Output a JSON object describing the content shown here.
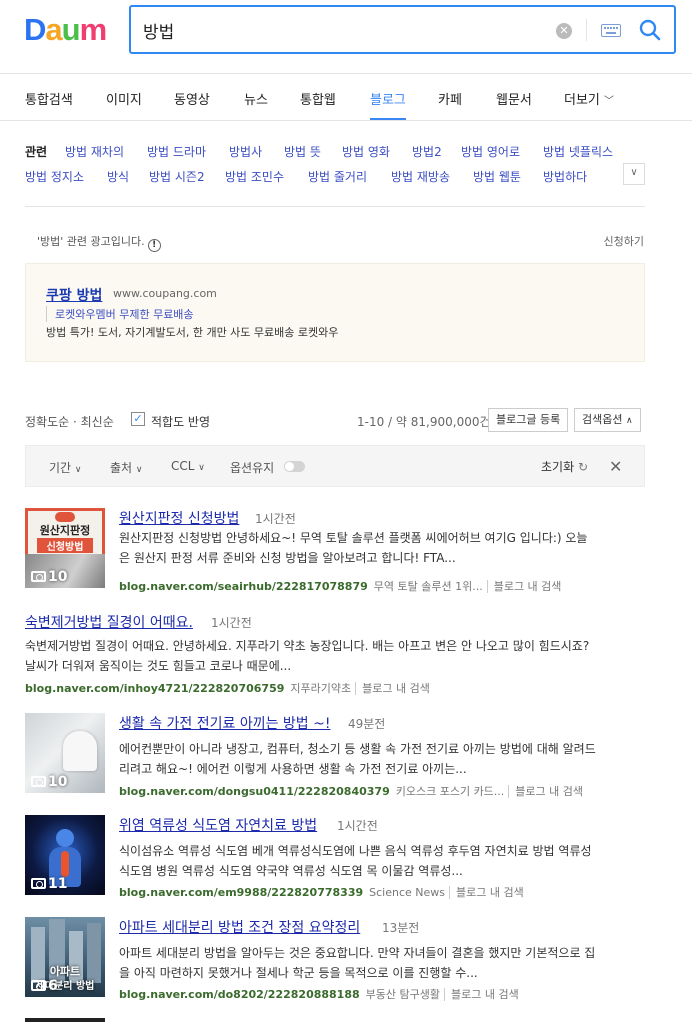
{
  "header": {
    "logo": [
      "D",
      "a",
      "u",
      "m"
    ],
    "logo_colors": [
      "#2b73f0",
      "#f5a623",
      "#4cbf4a",
      "#f23e6f"
    ],
    "query": "방법"
  },
  "tabs": [
    "통합검색",
    "이미지",
    "동영상",
    "뉴스",
    "통합웹",
    "블로그",
    "카페",
    "웹문서",
    "더보기"
  ],
  "active_tab": "블로그",
  "related": {
    "label": "관련",
    "row1": [
      "방법 재차의",
      "방법 드라마",
      "방법사",
      "방법 뜻",
      "방법 영화",
      "방법2",
      "방법 영어로",
      "방법 넷플릭스"
    ],
    "row2": [
      "방법 정지소",
      "방식",
      "방법 시즌2",
      "방법 조민수",
      "방법 줄거리",
      "방법 재방송",
      "방법 웹툰",
      "방법하다"
    ]
  },
  "ad": {
    "note": "'방법' 관련 광고입니다.",
    "info_icon": "!",
    "apply": "신청하기",
    "title": "쿠팡 방법",
    "url": "www.coupang.com",
    "sub": "로켓와우멤버 무제한 무료배송",
    "desc": "방법 특가! 도서, 자기계발도서, 한 개만 사도 무료배송 로켓와우"
  },
  "sort": {
    "accuracy": "정확도순",
    "latest": "최신순",
    "relevance": "적합도 반영",
    "count": "1-10 / 약 81,900,000건",
    "register": "블로그글 등록",
    "options": "검색옵션"
  },
  "filters": {
    "period": "기간",
    "source": "출처",
    "ccl": "CCL",
    "keep_option": "옵션유지",
    "reset": "초기화",
    "close": "✕"
  },
  "results": [
    {
      "title": "원산지판정 신청방법",
      "time": "1시간전",
      "desc1": "원산지판정 신청방법   안녕하세요~! 무역 토탈 솔루션 플랫폼 씨에어허브 여기G 입니다:)  오늘",
      "desc2": "은 원산지 판정 서류 준비와 신청 방법을 알아보려고 합니다!  FTA...",
      "url": "blog.naver.com/seairhub/222817078879",
      "blog_name": "무역 토탈 솔루션 1위...",
      "inside": "블로그 내 검색",
      "thumb_count": "10",
      "thumb_text1": "원산지판정",
      "thumb_text2": "신청방법"
    },
    {
      "title": "숙변제거방법 질경이 어때요.",
      "time": "1시간전",
      "desc1": "숙변제거방법 질경이 어때요. 안녕하세요. 지푸라기 약초 농장입니다. 배는 아프고 변은 안 나오고 많이 힘드시죠?",
      "desc2": "날씨가 더워져 움직이는 것도 힘들고 코로나 때문에...",
      "url": "blog.naver.com/inhoy4721/222820706759",
      "blog_name": "지푸라기약초",
      "inside": "블로그 내 검색"
    },
    {
      "title": "생활 속 가전 전기료 아끼는 방법 ~!",
      "time": "49분전",
      "desc1": "에어컨뿐만이 아니라 냉장고, 컴퓨터, 청소기 등 생활 속 가전 전기료 아끼는 방법에 대해 알려드",
      "desc2": "리려고 해요~!   에어컨 이렇게 사용하면 생활 속 가전 전기료 아끼는...",
      "url": "blog.naver.com/dongsu0411/222820840379",
      "blog_name": "키오스크 포스기 카드...",
      "inside": "블로그 내 검색",
      "thumb_count": "10"
    },
    {
      "title": "위염 역류성 식도염 자연치료 방법",
      "time": "1시간전",
      "desc1": "식이섬유소 역류성 식도염 베개 역류성식도염에 나쁜 음식 역류성 후두염 자연치료 방법 역류성",
      "desc2": "식도염 병원 역류성 식도염 약국약 역류성 식도염 목 이물감 역류성...",
      "url": "blog.naver.com/em9988/222820778339",
      "blog_name": "Science News",
      "inside": "블로그 내 검색",
      "thumb_count": "11"
    },
    {
      "title": "아파트 세대분리 방법 조건 장점 요약정리",
      "time": "13분전",
      "desc1": "아파트 세대분리 방법을 알아두는 것은 중요합니다. 만약 자녀들이 결혼을 했지만 기본적으로 집",
      "desc2": "을 아직 마련하지 못했거나 절세나 학군 등을 목적으로 이를 진행할 수...",
      "url": "blog.naver.com/do8202/222820888188",
      "blog_name": "부동산 탐구생활",
      "inside": "블로그 내 검색",
      "thumb_count": "6",
      "thumb_text1": "아파트",
      "thumb_text2": "세대분리 방법"
    }
  ]
}
